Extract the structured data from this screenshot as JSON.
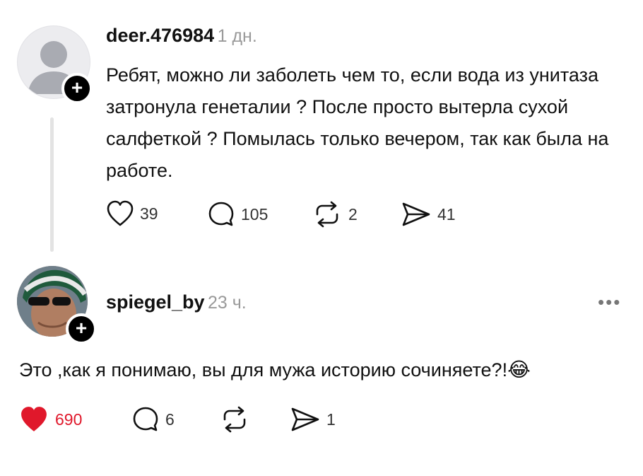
{
  "post": {
    "username": "deer.476984",
    "time": "1 дн.",
    "text": "Ребят, можно ли заболеть чем то, если вода из унитаза затронула генеталии ? После просто вытерла сухой салфеткой ? Помылась только вечером, так как была на работе.",
    "likes": "39",
    "comments": "105",
    "reposts": "2",
    "shares": "41",
    "avatar_icon": "default-user-avatar",
    "follow_symbol": "+"
  },
  "reply": {
    "username": "spiegel_by",
    "time": "23 ч.",
    "text": "Это ,как я понимаю, вы для мужа историю сочиняете?!",
    "emoji": "😂",
    "likes": "690",
    "comments": "6",
    "shares": "1",
    "more": "•••",
    "follow_symbol": "+",
    "like_color": "#e0182b"
  }
}
